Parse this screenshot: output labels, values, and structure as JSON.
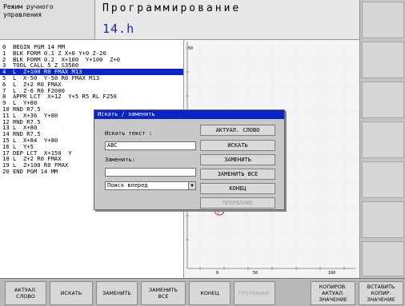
{
  "header": {
    "mode": "Режим ручного\nуправления",
    "title": "Программирование",
    "filename": "14.h"
  },
  "program": {
    "lines": [
      "0  BEGIN PGM 14 MM",
      "1  BLK FORM 0.1 Z X+0 Y+0 Z-20",
      "2  BLK FORM 0.2  X+100  Y+100  Z+0",
      "3  TOOL CALL 5 Z S3500",
      "4  L  Z+100 R0 FMAX M13",
      "5  L  X-50  Y-50 R0 FMAX M13",
      "6  L  Z+2 R0 FMAX",
      "7  L  Z-6 R0 F2000",
      "8  APPR LCT  X+12  Y+5 R5 RL F250",
      "9  L  Y+80",
      "10 RND R7.5",
      "11 L  X+36  Y+80",
      "12 RND R7.5",
      "13 L  X+80",
      "14 RND R7.5",
      "15 L  X+84  Y+80",
      "16 L  Y+5",
      "17 DEP LCT  X+150  Y",
      "18 L  Z+2 R0 FMAX",
      "19 L  Z+100 R0 FMAX",
      "20 END PGM 14 MM",
      "",
      "",
      "",
      "",
      "",
      ""
    ]
  },
  "graphic": {
    "ylabel_top": "50",
    "ylabel_mid": "0",
    "xlabel_0": "0",
    "xlabel_50": "50",
    "xlabel_100": "100"
  },
  "dialog": {
    "title": "Искать / заменить",
    "search_label": "Искать текст :",
    "search_value": "ABC",
    "replace_label": "Заменить:",
    "replace_value": "",
    "direction": "Поиск вперед",
    "buttons": [
      "АКТУАЛ. СЛОВО",
      "ИСКАТЬ",
      "ЗАМЕНИТЬ",
      "ЗАМЕНИТЬ ВСЕ",
      "КОНЕЦ",
      "ПРЕРВАНИЕ"
    ]
  },
  "softkeys": [
    "АКТУАЛ.\nСЛОВО",
    "ИСКАТЬ",
    "ЗАМЕНИТЬ",
    "ЗАМЕНИТЬ\nВСЕ",
    "КОНЕЦ",
    "ПРЕРВАНИЕ",
    "КОПИРОВ.\nАКТУАЛ.\nЗНАЧЕНИЕ",
    "ВСТАВИТЬ\nКОПИР.\nЗНАЧЕНИЕ"
  ],
  "colors": {
    "selection": "#0a24c8",
    "filename": "#1a28a0",
    "datum": "#d03030"
  }
}
